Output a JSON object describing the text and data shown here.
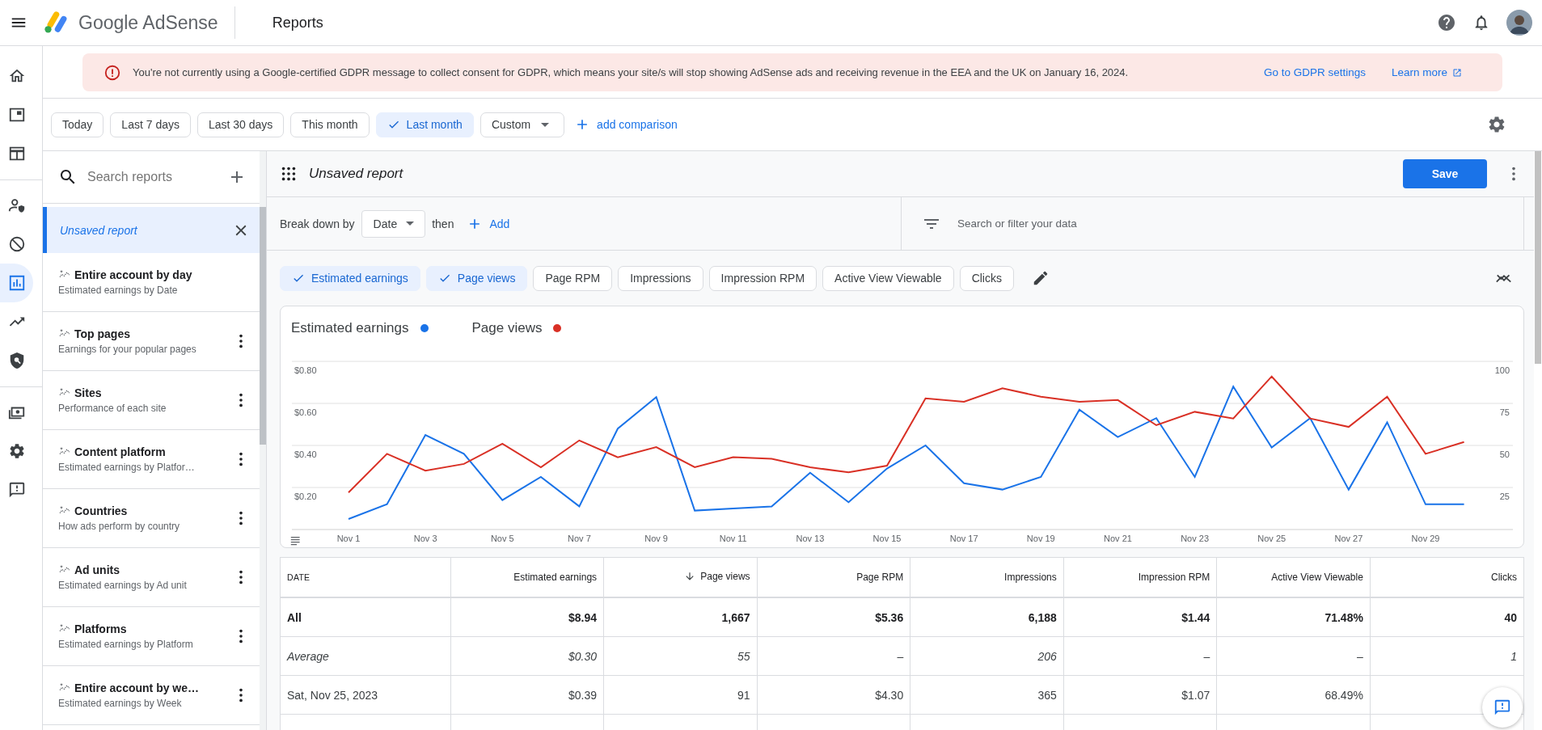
{
  "app_bar": {
    "product": "Google AdSense",
    "page_title": "Reports"
  },
  "nav_sections": [
    {
      "items": [
        {
          "kind": "home",
          "selected": false
        },
        {
          "kind": "ads",
          "selected": false
        },
        {
          "kind": "sites",
          "selected": false
        }
      ]
    },
    {
      "items": [
        {
          "kind": "privacy",
          "selected": false
        },
        {
          "kind": "blocking",
          "selected": false
        },
        {
          "kind": "reports",
          "selected": true
        },
        {
          "kind": "optimization",
          "selected": false
        },
        {
          "kind": "policy",
          "selected": false
        }
      ]
    },
    {
      "items": [
        {
          "kind": "payments",
          "selected": false
        },
        {
          "kind": "settings",
          "selected": false
        },
        {
          "kind": "feedback",
          "selected": false
        }
      ]
    }
  ],
  "banner": {
    "message": "You're not currently using a Google-certified GDPR message to collect consent for GDPR, which means your site/s will stop showing AdSense ads and receiving revenue in the EEA and the UK on January 16, 2024.",
    "actions": [
      {
        "label": "Go to GDPR settings",
        "external": false
      },
      {
        "label": "Learn more",
        "external": true
      }
    ]
  },
  "date_filters": [
    {
      "label": "Today",
      "kind": "chip",
      "selected": false
    },
    {
      "label": "Last 7 days",
      "kind": "chip",
      "selected": false
    },
    {
      "label": "Last 30 days",
      "kind": "chip",
      "selected": false
    },
    {
      "label": "This month",
      "kind": "chip",
      "selected": false
    },
    {
      "label": "Last month",
      "kind": "chip",
      "selected": true
    },
    {
      "label": "Custom",
      "kind": "dropdown",
      "selected": false
    }
  ],
  "add_comparison": "add comparison",
  "report_list": {
    "search_placeholder": "Search reports",
    "current": {
      "title": "Unsaved report",
      "selected": true
    },
    "items": [
      {
        "title": "Entire account by day",
        "subtitle": "Estimated earnings by Date",
        "has_menu": false
      },
      {
        "title": "Top pages",
        "subtitle": "Earnings for your popular pages",
        "has_menu": true
      },
      {
        "title": "Sites",
        "subtitle": "Performance of each site",
        "has_menu": true
      },
      {
        "title": "Content platform",
        "subtitle": "Estimated earnings by Platfor…",
        "has_menu": true
      },
      {
        "title": "Countries",
        "subtitle": "How ads perform by country",
        "has_menu": true
      },
      {
        "title": "Ad units",
        "subtitle": "Estimated earnings by Ad unit",
        "has_menu": true
      },
      {
        "title": "Platforms",
        "subtitle": "Estimated earnings by Platform",
        "has_menu": true
      },
      {
        "title": "Entire account by we…",
        "subtitle": "Estimated earnings by Week",
        "has_menu": true
      }
    ]
  },
  "report": {
    "title": "Unsaved report",
    "save": "Save",
    "breakdown_label": "Break down by",
    "dimension": "Date",
    "then": "then",
    "add": "Add",
    "filter_placeholder": "Search or filter your data"
  },
  "metrics": [
    {
      "label": "Estimated earnings",
      "selected": true
    },
    {
      "label": "Page views",
      "selected": true
    },
    {
      "label": "Page RPM",
      "selected": false
    },
    {
      "label": "Impressions",
      "selected": false
    },
    {
      "label": "Impression RPM",
      "selected": false
    },
    {
      "label": "Active View Viewable",
      "selected": false
    },
    {
      "label": "Clicks",
      "selected": false
    }
  ],
  "chart": {
    "charts": [
      {
        "chart_data": {
          "type": "line",
          "grid": true,
          "categories": [
            "Nov 1",
            null,
            "Nov 3",
            null,
            "Nov 5",
            null,
            "Nov 7",
            null,
            "Nov 9",
            null,
            "Nov 11",
            null,
            "Nov 13",
            null,
            "Nov 15",
            null,
            "Nov 17",
            null,
            "Nov 19",
            null,
            "Nov 21",
            null,
            "Nov 23",
            null,
            "Nov 25",
            null,
            "Nov 27",
            null,
            "Nov 29",
            null
          ],
          "ylim": [
            0,
            0.8
          ],
          "yticks": [
            {
              "value": 0.2,
              "label": "$0.20"
            },
            {
              "value": 0.4,
              "label": "$0.40"
            },
            {
              "value": 0.6,
              "label": "$0.60"
            },
            {
              "value": 0.8,
              "label": "$0.80"
            }
          ],
          "series": [
            {
              "name": "Estimated earnings",
              "color": "#1a73e8",
              "values": [
                0.05,
                0.12,
                0.45,
                0.36,
                0.14,
                0.25,
                0.11,
                0.48,
                0.63,
                0.09,
                0.1,
                0.11,
                0.27,
                0.13,
                0.29,
                0.4,
                0.22,
                0.19,
                0.25,
                0.57,
                0.44,
                0.53,
                0.25,
                0.68,
                0.39,
                0.53,
                0.19,
                0.51,
                0.12,
                0.12
              ]
            }
          ]
        }
      },
      {
        "chart_data": {
          "type": "line",
          "categories": [
            null,
            null,
            null,
            null,
            null,
            null,
            null,
            null,
            null,
            null,
            null,
            null,
            null,
            null,
            null,
            null,
            null,
            null,
            null,
            null,
            null,
            null,
            null,
            null,
            null,
            null,
            null,
            null,
            null,
            null
          ],
          "ylim": [
            0,
            100
          ],
          "yticks": [
            {
              "value": 25,
              "label": "25"
            },
            {
              "value": 50,
              "label": "50"
            },
            {
              "value": 75,
              "label": "75"
            },
            {
              "value": 100,
              "label": "100"
            }
          ],
          "series": [
            {
              "name": "Page views",
              "color": "#d93025",
              "values": [
                22,
                45,
                35,
                39,
                51,
                37,
                53,
                43,
                49,
                37,
                43,
                42,
                37,
                34,
                38,
                78,
                76,
                84,
                79,
                76,
                77,
                62,
                70,
                66,
                91,
                66,
                61,
                79,
                45,
                52
              ]
            }
          ]
        }
      }
    ]
  },
  "table": {
    "columns": [
      {
        "label": "DATE",
        "sorted": false
      },
      {
        "label": "Estimated earnings",
        "sorted": false
      },
      {
        "label": "Page views",
        "sorted": true
      },
      {
        "label": "Page RPM",
        "sorted": false
      },
      {
        "label": "Impressions",
        "sorted": false
      },
      {
        "label": "Impression RPM",
        "sorted": false
      },
      {
        "label": "Active View Viewable",
        "sorted": false
      },
      {
        "label": "Clicks",
        "sorted": false
      }
    ],
    "rows": [
      {
        "kind": "total",
        "cells": [
          "All",
          "$8.94",
          "1,667",
          "$5.36",
          "6,188",
          "$1.44",
          "71.48%",
          "40"
        ]
      },
      {
        "kind": "average",
        "cells": [
          "Average",
          "$0.30",
          "55",
          "–",
          "206",
          "–",
          "–",
          "1"
        ]
      },
      {
        "kind": "data",
        "cells": [
          "Sat, Nov 25, 2023",
          "$0.39",
          "91",
          "$4.30",
          "365",
          "$1.07",
          "68.49%"
        ]
      }
    ]
  }
}
